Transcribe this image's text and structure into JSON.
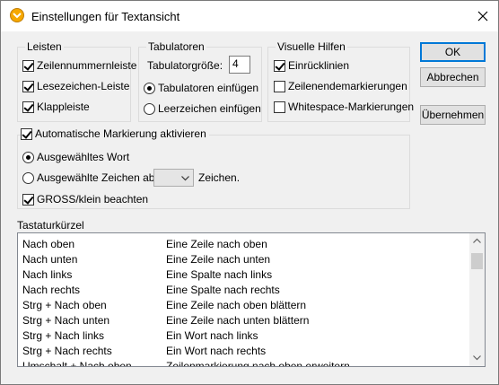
{
  "window": {
    "title": "Einstellungen für Textansicht"
  },
  "leisten": {
    "label": "Leisten",
    "items": [
      {
        "label": "Zeilennummernleiste",
        "checked": true
      },
      {
        "label": "Lesezeichen-Leiste",
        "checked": true
      },
      {
        "label": "Klappleiste",
        "checked": true
      }
    ]
  },
  "tabulatoren": {
    "label": "Tabulatoren",
    "size_label": "Tabulatorgröße:",
    "size_value": "4",
    "options": [
      {
        "label": "Tabulatoren einfügen",
        "selected": true
      },
      {
        "label": "Leerzeichen einfügen",
        "selected": false
      }
    ]
  },
  "visuelle": {
    "label": "Visuelle Hilfen",
    "items": [
      {
        "label": "Einrücklinien",
        "checked": true
      },
      {
        "label": "Zeilenendemarkierungen",
        "checked": false
      },
      {
        "label": "Whitespace-Markierungen",
        "checked": false
      }
    ]
  },
  "buttons": {
    "ok": "OK",
    "cancel": "Abbrechen",
    "apply": "Übernehmen"
  },
  "markierung": {
    "label": "Automatische Markierung aktivieren",
    "enabled": true,
    "option_word": "Ausgewähltes Wort",
    "option_chars": "Ausgewählte Zeichen ab:",
    "chars_value": "",
    "chars_suffix": "Zeichen.",
    "case_label": "GROSS/klein beachten",
    "case_checked": true
  },
  "tastatur": {
    "label": "Tastaturkürzel",
    "rows": [
      {
        "key": "Nach oben",
        "desc": "Eine Zeile nach oben"
      },
      {
        "key": "Nach unten",
        "desc": "Eine Zeile nach unten"
      },
      {
        "key": "Nach links",
        "desc": "Eine Spalte nach links"
      },
      {
        "key": "Nach rechts",
        "desc": "Eine Spalte nach rechts"
      },
      {
        "key": "Strg + Nach oben",
        "desc": "Eine Zeile nach oben blättern"
      },
      {
        "key": "Strg + Nach unten",
        "desc": "Eine Zeile nach unten blättern"
      },
      {
        "key": "Strg +  Nach links",
        "desc": "Ein Wort nach links"
      },
      {
        "key": "Strg + Nach rechts",
        "desc": "Ein Wort nach rechts"
      },
      {
        "key": "Umschalt + Nach oben",
        "desc": "Zeilenmarkierung nach oben erweitern"
      }
    ]
  },
  "icons": {
    "app": "altova-app-icon",
    "close": "close-icon",
    "dropdown": "chevron-down-icon",
    "scroll_up": "scroll-up-arrow-icon",
    "scroll_down": "scroll-down-arrow-icon"
  },
  "colors": {
    "accent": "#0078d7",
    "app_icon": "#f6a800"
  }
}
